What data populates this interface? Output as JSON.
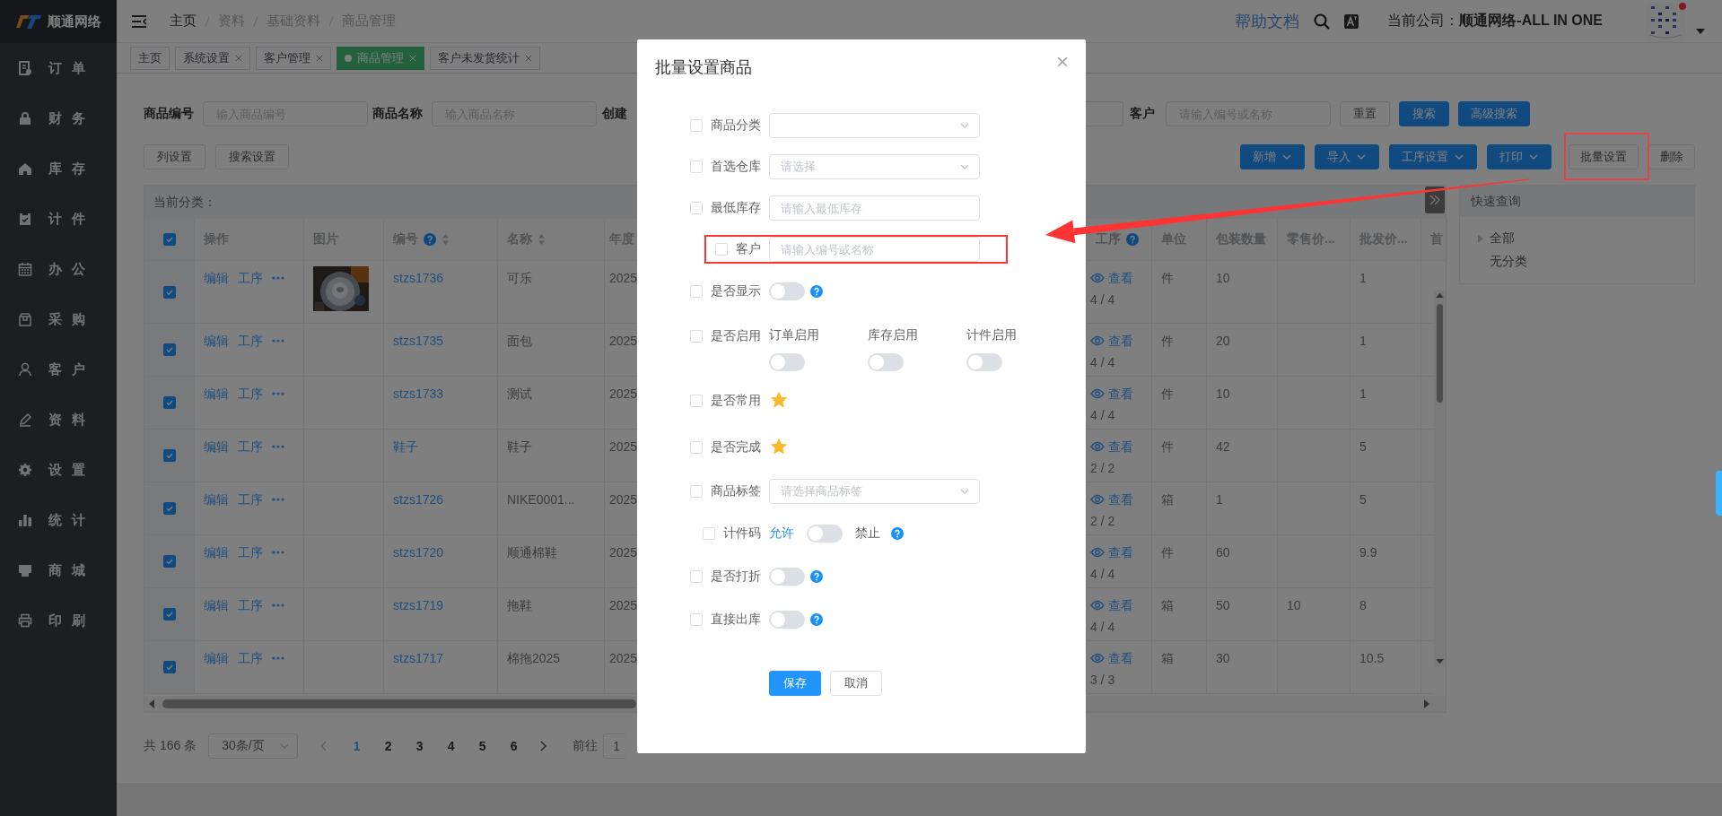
{
  "sidebar": {
    "logo": "顺通网络",
    "items": [
      {
        "label": "订单"
      },
      {
        "label": "财务"
      },
      {
        "label": "库存"
      },
      {
        "label": "计件"
      },
      {
        "label": "办公"
      },
      {
        "label": "采购"
      },
      {
        "label": "客户"
      },
      {
        "label": "资料"
      },
      {
        "label": "设置"
      },
      {
        "label": "统计"
      },
      {
        "label": "商城"
      },
      {
        "label": "印刷"
      }
    ]
  },
  "topbar": {
    "breadcrumb": [
      "主页",
      "资料",
      "基础资料",
      "商品管理"
    ],
    "help_link": "帮助文档",
    "company_label": "当前公司：",
    "company_name": "顺通网络-ALL IN ONE"
  },
  "tabs": [
    {
      "label": "主页",
      "closable": false,
      "selected": false
    },
    {
      "label": "系统设置",
      "closable": true,
      "selected": false
    },
    {
      "label": "客户管理",
      "closable": true,
      "selected": false
    },
    {
      "label": "商品管理",
      "closable": true,
      "selected": true
    },
    {
      "label": "客户未发货统计",
      "closable": true,
      "selected": false
    }
  ],
  "search": {
    "fields": [
      {
        "label": "商品编号",
        "placeholder": "输入商品编号"
      },
      {
        "label": "商品名称",
        "placeholder": "输入商品名称"
      }
    ],
    "third_field_label": "创建",
    "customer": {
      "label": "客户",
      "placeholder": "请输入编号或名称"
    },
    "buttons": [
      {
        "label": "重置",
        "kind": "plain"
      },
      {
        "label": "搜索",
        "kind": "primary"
      },
      {
        "label": "高级搜索",
        "kind": "primary"
      }
    ]
  },
  "toolbar": {
    "left_buttons": [
      "列设置",
      "搜索设置"
    ],
    "right_buttons": [
      {
        "label": "新增",
        "kind": "dropdown",
        "highlighted": false
      },
      {
        "label": "导入",
        "kind": "dropdown",
        "highlighted": false
      },
      {
        "label": "工序设置",
        "kind": "dropdown",
        "highlighted": false
      },
      {
        "label": "打印",
        "kind": "dropdown",
        "highlighted": false
      },
      {
        "label": "批量设置",
        "kind": "plain",
        "highlighted": true
      },
      {
        "label": "删除",
        "kind": "plain",
        "highlighted": false
      }
    ]
  },
  "table": {
    "category_label": "当前分类：",
    "all_checked": true,
    "columns": [
      {
        "label": "操作"
      },
      {
        "label": "图片"
      },
      {
        "label": "编号",
        "help": true,
        "sortable": true
      },
      {
        "label": "名称",
        "sortable": true
      },
      {
        "label": "年度"
      },
      {
        "label": "工序",
        "help": true
      },
      {
        "label": "单位"
      },
      {
        "label": "包装数量"
      },
      {
        "label": "零售价..."
      },
      {
        "label": "批发价..."
      },
      {
        "label": "首"
      }
    ],
    "rows": [
      {
        "checked": true,
        "actions": [
          "编辑",
          "工序"
        ],
        "picture": {
          "kind": "picture"
        },
        "code": "stzs1736",
        "name": "可乐",
        "year": "2025",
        "process_link": "查看",
        "process_count": "4 / 4",
        "unit": "件",
        "pack_qty": "10",
        "wholesale_price": "1"
      },
      {
        "checked": true,
        "actions": [
          "编辑",
          "工序"
        ],
        "code": "stzs1735",
        "name": "面包",
        "year": "2025",
        "process_link": "查看",
        "process_count": "4 / 4",
        "unit": "件",
        "pack_qty": "20",
        "wholesale_price": "1"
      },
      {
        "checked": true,
        "actions": [
          "编辑",
          "工序"
        ],
        "code": "stzs1733",
        "name": "测试",
        "year": "2025",
        "process_link": "查看",
        "process_count": "4 / 4",
        "unit": "件",
        "pack_qty": "10",
        "wholesale_price": "1"
      },
      {
        "checked": true,
        "actions": [
          "编辑",
          "工序"
        ],
        "code": "鞋子",
        "name": "鞋子",
        "year": "2025",
        "process_link": "查看",
        "process_count": "2 / 2",
        "unit": "件",
        "pack_qty": "42",
        "wholesale_price": "5"
      },
      {
        "checked": true,
        "actions": [
          "编辑",
          "工序"
        ],
        "code": "stzs1726",
        "name": "NIKE0001...",
        "year": "2025",
        "process_link": "查看",
        "process_count": "2 / 2",
        "unit": "箱",
        "pack_qty": "1",
        "wholesale_price": "5"
      },
      {
        "checked": true,
        "actions": [
          "编辑",
          "工序"
        ],
        "code": "stzs1720",
        "name": "顺通棉鞋",
        "year": "2025",
        "process_link": "查看",
        "process_count": "4 / 4",
        "unit": "件",
        "pack_qty": "60",
        "wholesale_price": "9.9"
      },
      {
        "checked": true,
        "actions": [
          "编辑",
          "工序"
        ],
        "code": "stzs1719",
        "name": "拖鞋",
        "year": "2025",
        "process_link": "查看",
        "process_count": "4 / 4",
        "unit": "箱",
        "pack_qty": "50",
        "retail_price": "10",
        "wholesale_price": "8"
      },
      {
        "checked": true,
        "actions": [
          "编辑",
          "工序"
        ],
        "code": "stzs1717",
        "name": "棉拖2025",
        "year": "2025",
        "process_link": "查看",
        "process_count": "3 / 3",
        "unit": "箱",
        "pack_qty": "30",
        "wholesale_price": "10.5"
      }
    ]
  },
  "pagination": {
    "total": "共 166 条",
    "page_size": "30条/页",
    "pages": [
      {
        "label": "1",
        "selected": true
      },
      {
        "label": "2",
        "selected": false
      },
      {
        "label": "3",
        "selected": false
      },
      {
        "label": "4",
        "selected": false
      },
      {
        "label": "5",
        "selected": false
      },
      {
        "label": "6",
        "selected": false
      }
    ],
    "goto_label": "前往",
    "goto_value": "1"
  },
  "quick_query": {
    "title": "快速查询",
    "tree": [
      {
        "label": "全部",
        "kind": "branch"
      },
      {
        "label": "无分类",
        "kind": "leaf"
      }
    ]
  },
  "dialog": {
    "title": "批量设置商品",
    "rows": [
      {
        "kind": "select",
        "label": "商品分类",
        "checked": false,
        "highlighted": false
      },
      {
        "kind": "select",
        "label": "首选仓库",
        "placeholder": "请选择",
        "checked": false,
        "highlighted": false
      },
      {
        "kind": "input",
        "label": "最低库存",
        "placeholder": "请输入最低库存",
        "checked": false,
        "highlighted": false
      },
      {
        "kind": "input",
        "label": "客户",
        "placeholder": "请输入编号或名称",
        "checked": false,
        "highlighted": true
      },
      {
        "kind": "switch",
        "label": "是否显示",
        "checked": false,
        "highlighted": false,
        "on": false,
        "help": true
      },
      {
        "kind": "switch_group",
        "label": "是否启用",
        "checked": false,
        "highlighted": false,
        "switches": [
          {
            "label": "订单启用",
            "on": false
          },
          {
            "label": "库存启用",
            "on": false
          },
          {
            "label": "计件启用",
            "on": false
          }
        ]
      },
      {
        "kind": "star",
        "label": "是否常用",
        "checked": false,
        "highlighted": false,
        "on": true
      },
      {
        "kind": "star",
        "label": "是否完成",
        "checked": false,
        "highlighted": false,
        "on": true
      },
      {
        "kind": "select",
        "label": "商品标签",
        "placeholder": "请选择商品标签",
        "checked": false,
        "highlighted": false
      },
      {
        "kind": "toggle_pair",
        "label": "计件码",
        "checked": false,
        "highlighted": false,
        "left": "允许",
        "right": "禁止",
        "on": false,
        "help": true
      },
      {
        "kind": "switch",
        "label": "是否打折",
        "checked": false,
        "highlighted": false,
        "on": false,
        "help": true
      },
      {
        "kind": "switch",
        "label": "直接出库",
        "checked": false,
        "highlighted": false,
        "on": false,
        "help": true
      }
    ],
    "buttons": [
      {
        "label": "保存",
        "kind": "primary"
      },
      {
        "label": "取消",
        "kind": "plain"
      }
    ]
  }
}
